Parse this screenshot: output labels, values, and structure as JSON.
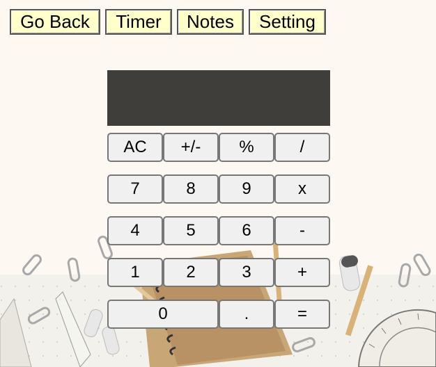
{
  "nav": {
    "go_back": "Go Back",
    "timer": "Timer",
    "notes": "Notes",
    "setting": "Setting"
  },
  "calculator": {
    "display_value": "",
    "keys": {
      "ac": "AC",
      "sign": "+/-",
      "percent": "%",
      "divide": "/",
      "seven": "7",
      "eight": "8",
      "nine": "9",
      "multiply": "x",
      "four": "4",
      "five": "5",
      "six": "6",
      "subtract": "-",
      "one": "1",
      "two": "2",
      "three": "3",
      "add": "+",
      "zero": "0",
      "decimal": ".",
      "equals": "="
    }
  },
  "colors": {
    "page_background": "#fdf8f2",
    "nav_button": "#ffffcc",
    "display_background": "#403e3b",
    "key_background": "#f0f0f0"
  }
}
